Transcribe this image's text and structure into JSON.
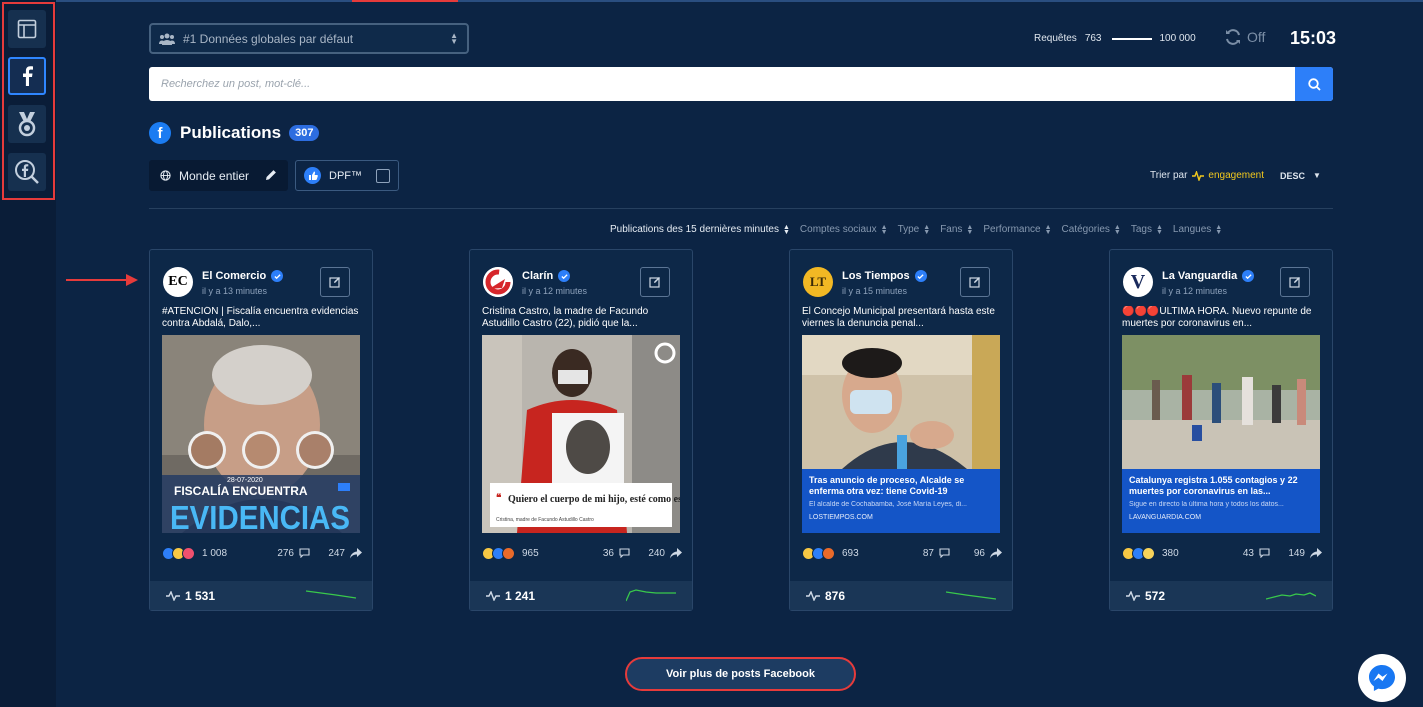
{
  "header": {
    "dataset_select": "#1 Données globales par défaut",
    "requests_label": "Requêtes",
    "requests_used": "763",
    "requests_limit": "100 000",
    "refresh_status": "Off",
    "clock": "15:03"
  },
  "search": {
    "placeholder": "Recherchez un post, mot-clé..."
  },
  "section": {
    "title": "Publications",
    "count": "307",
    "region": "Monde entier",
    "dpf_label": "DPF™",
    "sort_label": "Trier par",
    "sort_field": "engagement",
    "sort_dir": "DESC"
  },
  "filters": [
    "Publications des 15 dernières minutes",
    "Comptes sociaux",
    "Type",
    "Fans",
    "Performance",
    "Catégories",
    "Tags",
    "Langues"
  ],
  "posts": [
    {
      "name": "El Comercio",
      "avatar": "EC",
      "time": "il y a 13 minutes",
      "text": "#ATENCIÓN | Fiscalía encuentra evidencias contra Abdalá, Dalo,...",
      "media_date": "28-07-2020",
      "media_caption": "FISCALÍA ENCUENTRA",
      "media_big": "EVIDENCIAS",
      "reactions": "1 008",
      "comments": "276",
      "shares": "247",
      "engagement": "1 531",
      "spark_color": "#39c94b"
    },
    {
      "name": "Clarín",
      "avatar": "C",
      "time": "il y a 12 minutes",
      "text": "Cristina Castro, la madre de Facundo Astudillo Castro (22), pidió que la...",
      "media_quote": "Quiero el cuerpo de mi hijo, esté como esté\".",
      "media_attr": "Cristina, madre de Facundo Astudillo Castro",
      "reactions": "965",
      "comments": "36",
      "shares": "240",
      "engagement": "1 241",
      "spark_color": "#39c94b"
    },
    {
      "name": "Los Tiempos",
      "avatar": "LT",
      "time": "il y a 15 minutes",
      "text": "El Concejo Municipal presentará hasta este viernes la denuncia penal...",
      "link_title": "Tras anuncio de proceso, Alcalde se enferma otra vez: tiene Covid-19",
      "link_desc": "El alcalde de Cochabamba, José María Leyes, di...",
      "link_url": "LOSTIEMPOS.COM",
      "reactions": "693",
      "comments": "87",
      "shares": "96",
      "engagement": "876",
      "spark_color": "#39c94b"
    },
    {
      "name": "La Vanguardia",
      "avatar": "V",
      "time": "il y a 12 minutes",
      "text": "🔴🔴🔴ÚLTIMA HORA. Nuevo repunte de muertes por coronavirus en...",
      "link_title": "Catalunya registra 1.055 contagios y 22 muertes por coronavirus en las...",
      "link_desc": "Sigue en directo la última hora y todos los datos...",
      "link_url": "LAVANGUARDIA.COM",
      "reactions": "380",
      "comments": "43",
      "shares": "149",
      "engagement": "572",
      "spark_color": "#39c94b"
    }
  ],
  "more_button": "Voir plus de posts Facebook"
}
